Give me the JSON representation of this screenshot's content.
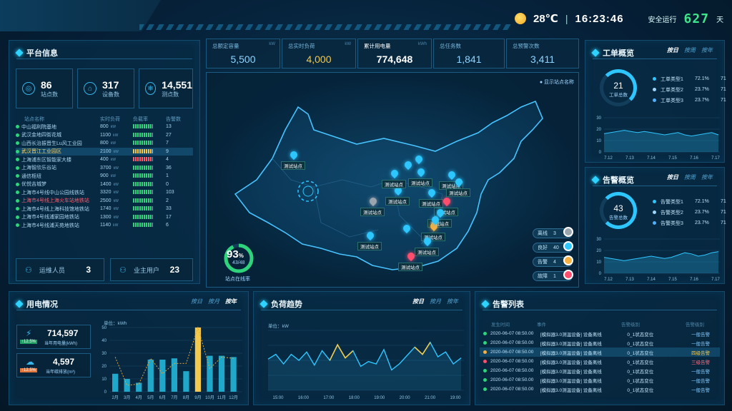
{
  "header": {
    "temp": "28℃",
    "sep": "|",
    "time": "16:23:46",
    "safe_label": "安全运行",
    "safe_days": "627",
    "days_unit": "天"
  },
  "platform": {
    "title": "平台信息",
    "stats": [
      {
        "value": "86",
        "label": "站点数"
      },
      {
        "value": "317",
        "label": "设备数"
      },
      {
        "value": "14,551",
        "label": "测点数"
      }
    ],
    "table_headers": [
      "站点名称",
      "实时负荷",
      "负载率",
      "告警数"
    ],
    "rows": [
      {
        "name": "中山福利院基地",
        "load": "800",
        "unit": "kW",
        "rate_color": "#2ed37b",
        "alarms": "13",
        "hl": false,
        "red": false
      },
      {
        "name": "武汉金地四街花城",
        "load": "1100",
        "unit": "kW",
        "rate_color": "#2ed37b",
        "alarms": "27",
        "hl": false,
        "red": false
      },
      {
        "name": "山西长治振晋生Lu风工业园",
        "load": "800",
        "unit": "kW",
        "rate_color": "#2ed37b",
        "alarms": "7",
        "hl": false,
        "red": false
      },
      {
        "name": "武汉晋江工业园区",
        "load": "2100",
        "unit": "kW",
        "rate_color": "#f2c94c",
        "alarms": "9",
        "hl": true,
        "red": false
      },
      {
        "name": "上海浦东区智能家大楼",
        "load": "400",
        "unit": "kW",
        "rate_color": "#ff5a6a",
        "alarms": "4",
        "hl": false,
        "red": false
      },
      {
        "name": "上海智欣乐谷站",
        "load": "3700",
        "unit": "kW",
        "rate_color": "#2ed37b",
        "alarms": "36",
        "hl": false,
        "red": false
      },
      {
        "name": "通信枢纽",
        "load": "900",
        "unit": "kW",
        "rate_color": "#2ed37b",
        "alarms": "1",
        "hl": false,
        "red": false
      },
      {
        "name": "优悦吉城梦",
        "load": "1400",
        "unit": "kW",
        "rate_color": "#2ed37b",
        "alarms": "0",
        "hl": false,
        "red": false
      },
      {
        "name": "上海市4号线中山公园线铁站",
        "load": "3320",
        "unit": "kW",
        "rate_color": "#2ed37b",
        "alarms": "103",
        "hl": false,
        "red": false
      },
      {
        "name": "上海市4号线上海火车站地铁站",
        "load": "2500",
        "unit": "kW",
        "rate_color": "#2ed37b",
        "alarms": "2",
        "hl": false,
        "red": true
      },
      {
        "name": "上海市4号线上海科技馆地铁站",
        "load": "1740",
        "unit": "kW",
        "rate_color": "#2ed37b",
        "alarms": "33",
        "hl": false,
        "red": false
      },
      {
        "name": "上海市4号线浦家园地铁站",
        "load": "1300",
        "unit": "kW",
        "rate_color": "#2ed37b",
        "alarms": "17",
        "hl": false,
        "red": false
      },
      {
        "name": "上海市4号线浦天苑地铁站",
        "load": "1140",
        "unit": "kW",
        "rate_color": "#2ed37b",
        "alarms": "6",
        "hl": false,
        "red": false
      }
    ],
    "ops_label": "运维人员",
    "ops_count": "3",
    "owner_label": "业主用户",
    "owner_count": "23"
  },
  "kpis": [
    {
      "title": "总额定容量",
      "unit": "kW",
      "value": "5,500",
      "color": "#8fd3ff"
    },
    {
      "title": "总实时负荷",
      "unit": "kW",
      "value": "4,000",
      "color": "#f2c94c"
    },
    {
      "title": "累计用电量",
      "unit": "kWh",
      "value": "774,648",
      "color": "#ffffff"
    },
    {
      "title": "总任务数",
      "unit": "",
      "value": "1,841",
      "color": "#8fd3ff"
    },
    {
      "title": "总预警次数",
      "unit": "",
      "value": "3,411",
      "color": "#8fd3ff"
    }
  ],
  "map": {
    "show_names": "显示站点名称",
    "station_label": "测试站点",
    "online_pct": "93",
    "pct_sign": "%",
    "online_ratio": "43/48",
    "online_label": "站点在线率",
    "legend": [
      {
        "label": "离线",
        "count": "3",
        "color": "#9aa5ae"
      },
      {
        "label": "良好",
        "count": "40",
        "color": "#2ec6ff"
      },
      {
        "label": "告警",
        "count": "4",
        "color": "#f5b041"
      },
      {
        "label": "故障",
        "count": "1",
        "color": "#ff4d6d"
      }
    ]
  },
  "workorder": {
    "title": "工单概览",
    "tabs": [
      "按日",
      "按周",
      "按年"
    ],
    "active_tab": 0,
    "total": "21",
    "total_label": "工单总数",
    "items": [
      {
        "label": "工单类型1",
        "pct": "72.1%",
        "count": "71",
        "color": "#2ec6ff"
      },
      {
        "label": "工单类型2",
        "pct": "23.7%",
        "count": "71",
        "color": "#9fd6ff"
      },
      {
        "label": "工单类型3",
        "pct": "23.7%",
        "count": "71",
        "color": "#4fb0ff"
      }
    ],
    "chart_y": [
      "30",
      "20",
      "10",
      "0"
    ],
    "chart_x": [
      "7.12",
      "7.13",
      "7.14",
      "7.15",
      "7.16",
      "7.17"
    ]
  },
  "alarm_overview": {
    "title": "告警概览",
    "tabs": [
      "按日",
      "按周",
      "按年"
    ],
    "active_tab": 0,
    "total": "43",
    "total_label": "告警总数",
    "items": [
      {
        "label": "告警类型1",
        "pct": "72.1%",
        "count": "71",
        "color": "#2ec6ff"
      },
      {
        "label": "告警类型2",
        "pct": "23.7%",
        "count": "71",
        "color": "#9fd6ff"
      },
      {
        "label": "告警类型3",
        "pct": "23.7%",
        "count": "71",
        "color": "#4fb0ff"
      }
    ],
    "chart_y": [
      "30",
      "20",
      "10",
      "0"
    ],
    "chart_x": [
      "7.12",
      "7.13",
      "7.14",
      "7.15",
      "7.16",
      "7.17"
    ]
  },
  "usage": {
    "title": "用电情况",
    "tabs": [
      "按日",
      "按月",
      "按年"
    ],
    "active_tab": 2,
    "box1_value": "714,597",
    "box1_badge": "↑12.5%",
    "box1_label": "当年用电量(kWh)",
    "box2_value": "4,597",
    "box2_badge": "↑12.5%",
    "box2_label": "当年碳排放(m³)",
    "unit_label": "单位：kWh"
  },
  "chart_data": [
    {
      "type": "bar",
      "title": "",
      "ylabel": "单位：kWh",
      "ylim": [
        0,
        50
      ],
      "yticks": [
        0,
        10,
        20,
        30,
        40,
        50
      ],
      "categories": [
        "2月",
        "3月",
        "4月",
        "5月",
        "6月",
        "7月",
        "8月",
        "9月",
        "10月",
        "11月",
        "12月"
      ],
      "series": [
        {
          "name": "",
          "values": [
            14,
            10,
            7,
            25,
            25,
            26,
            16,
            50,
            28,
            28,
            27
          ],
          "highlight_index": 7
        },
        {
          "name": "",
          "values": [
            27,
            5,
            6,
            26,
            14,
            22,
            22,
            50,
            18,
            27,
            26
          ]
        }
      ]
    },
    {
      "type": "line",
      "title": "负荷趋势",
      "ylabel": "单位：kW",
      "ylim": [
        0,
        50
      ],
      "yticks": [
        0,
        10,
        20,
        30,
        40,
        50
      ],
      "x": [
        "15:00",
        "16:00",
        "17:00",
        "18:00",
        "19:00",
        "20:00",
        "21:00",
        "19:00"
      ],
      "series": [
        {
          "name": "",
          "values": [
            26,
            30,
            22,
            30,
            25,
            32,
            21,
            33,
            25,
            38,
            27,
            33,
            20,
            24,
            22,
            34,
            17,
            22,
            29,
            36,
            30,
            40,
            28,
            32,
            22,
            27
          ]
        }
      ]
    }
  ],
  "load_trend": {
    "title": "负荷趋势",
    "tabs": [
      "按日",
      "按月",
      "按年"
    ],
    "active_tab": 0,
    "unit_label": "单位：kW"
  },
  "alarm_list": {
    "title": "告警列表",
    "headers": [
      "发生时间",
      "事件",
      "告警级别",
      "",
      "告警级别"
    ],
    "rows": [
      {
        "time": "2020-06-07 08:50.00",
        "event": "[模拟器3.0测温设备] 设备离线",
        "type": "0_1状态变位",
        "level": "一般告警",
        "dot": "#2ed37b",
        "level_color": "#7ec9ff",
        "hl": false
      },
      {
        "time": "2020-06-07 08:50.00",
        "event": "[模拟器3.0测温设备] 设备离线",
        "type": "0_1状态变位",
        "level": "一般告警",
        "dot": "#2ed37b",
        "level_color": "#7ec9ff",
        "hl": false
      },
      {
        "time": "2020-06-07 08:50.00",
        "event": "[模拟器3.0测温设备] 设备离线",
        "type": "0_1状态变位",
        "level": "四级告警",
        "dot": "#f5b041",
        "level_color": "#f2c94c",
        "hl": true
      },
      {
        "time": "2020-06-07 08:50.00",
        "event": "[模拟器3.0测温设备] 设备离线",
        "type": "0_1状态变位",
        "level": "三级告警",
        "dot": "#ff4d6d",
        "level_color": "#ff6b7f",
        "hl": false
      },
      {
        "time": "2020-06-07 08:50.00",
        "event": "[模拟器3.0测温设备] 设备离线",
        "type": "0_1状态变位",
        "level": "一般告警",
        "dot": "#2ed37b",
        "level_color": "#7ec9ff",
        "hl": false
      },
      {
        "time": "2020-06-07 08:50.00",
        "event": "[模拟器3.0测温设备] 设备离线",
        "type": "0_1状态变位",
        "level": "一般告警",
        "dot": "#2ed37b",
        "level_color": "#7ec9ff",
        "hl": false
      },
      {
        "time": "2020-06-07 08:50.00",
        "event": "[模拟器3.0测温设备] 设备离线",
        "type": "0_1状态变位",
        "level": "一般告警",
        "dot": "#2ed37b",
        "level_color": "#7ec9ff",
        "hl": false
      }
    ]
  }
}
